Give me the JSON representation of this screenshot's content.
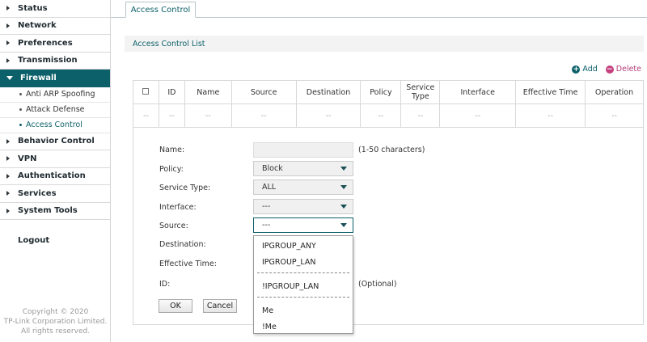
{
  "sidebar": {
    "items": [
      {
        "label": "Status"
      },
      {
        "label": "Network"
      },
      {
        "label": "Preferences"
      },
      {
        "label": "Transmission"
      },
      {
        "label": "Firewall"
      },
      {
        "label": "Behavior Control"
      },
      {
        "label": "VPN"
      },
      {
        "label": "Authentication"
      },
      {
        "label": "Services"
      },
      {
        "label": "System Tools"
      }
    ],
    "firewall_sub": [
      {
        "label": "Anti ARP Spoofing"
      },
      {
        "label": "Attack Defense"
      },
      {
        "label": "Access Control"
      }
    ],
    "logout": "Logout",
    "copyright": [
      "Copyright © 2020",
      "TP-Link Corporation Limited.",
      "All rights reserved."
    ]
  },
  "tab": {
    "label": "Access Control"
  },
  "section": {
    "title": "Access Control List"
  },
  "actions": {
    "add": "Add",
    "delete": "Delete",
    "add_icon": "+",
    "delete_icon": "−"
  },
  "table": {
    "headers": [
      "ID",
      "Name",
      "Source",
      "Destination",
      "Policy",
      "Service Type",
      "Interface",
      "Effective Time",
      "Operation"
    ],
    "empty_row": [
      "--",
      "--",
      "--",
      "--",
      "--",
      "--",
      "--",
      "--",
      "--",
      "--"
    ]
  },
  "form": {
    "name_label": "Name:",
    "name_value": "",
    "name_hint": "(1-50 characters)",
    "policy_label": "Policy:",
    "policy_value": "Block",
    "service_label": "Service Type:",
    "service_value": "ALL",
    "interface_label": "Interface:",
    "interface_value": "---",
    "source_label": "Source:",
    "source_value": "---",
    "destination_label": "Destination:",
    "effective_label": "Effective Time:",
    "id_label": "ID:",
    "id_hint": "(Optional)",
    "ok": "OK",
    "cancel": "Cancel"
  },
  "dropdown": {
    "options": [
      "IPGROUP_ANY",
      "IPGROUP_LAN",
      "!IPGROUP_LAN",
      "Me",
      "!Me"
    ]
  },
  "colors": {
    "accent": "#0c6069",
    "delete": "#c5407f"
  }
}
